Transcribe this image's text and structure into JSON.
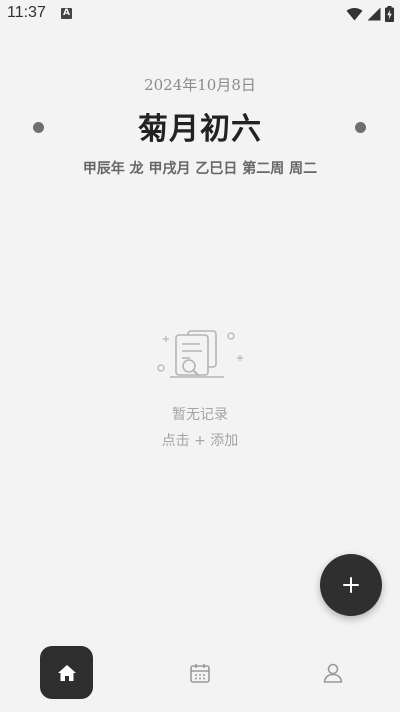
{
  "status_bar": {
    "time": "11:37",
    "app_indicator": "A",
    "icons": [
      "wifi-icon",
      "signal-icon",
      "battery-charging-icon"
    ]
  },
  "header": {
    "gregorian_date": "2024年10月8日",
    "lunar_date": "菊月初六",
    "ganzhi": "甲辰年 龙 甲戌月 乙巳日 第二周 周二"
  },
  "empty_state": {
    "title": "暂无记录",
    "hint": "点击 + 添加",
    "icon": "empty-records-icon"
  },
  "fab": {
    "icon": "plus-icon"
  },
  "bottom_nav": {
    "items": [
      {
        "id": "home",
        "icon": "home-icon",
        "active": true
      },
      {
        "id": "calendar",
        "icon": "calendar-icon",
        "active": false
      },
      {
        "id": "profile",
        "icon": "user-icon",
        "active": false
      }
    ]
  },
  "colors": {
    "background": "#f3f3f3",
    "accent_dark": "#2f2f2f",
    "muted_text": "#8a8a8a",
    "empty_text": "#a5a5a5"
  }
}
